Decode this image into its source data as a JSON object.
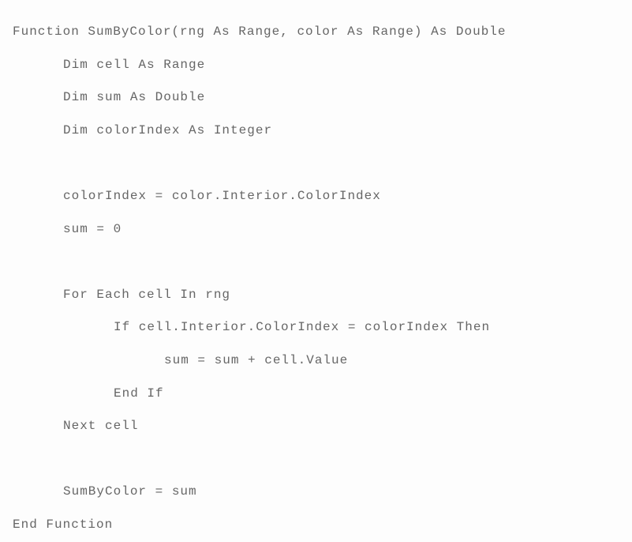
{
  "code": {
    "line1": "Function SumByColor(rng As Range, color As Range) As Double",
    "line2": "Dim cell As Range",
    "line3": "Dim sum As Double",
    "line4": "Dim colorIndex As Integer",
    "line5": "colorIndex = color.Interior.ColorIndex",
    "line6": "sum = 0",
    "line7": "For Each cell In rng",
    "line8": "If cell.Interior.ColorIndex = colorIndex Then",
    "line9": "sum = sum + cell.Value",
    "line10": "End If",
    "line11": "Next cell",
    "line12": "SumByColor = sum",
    "line13": "End Function"
  }
}
